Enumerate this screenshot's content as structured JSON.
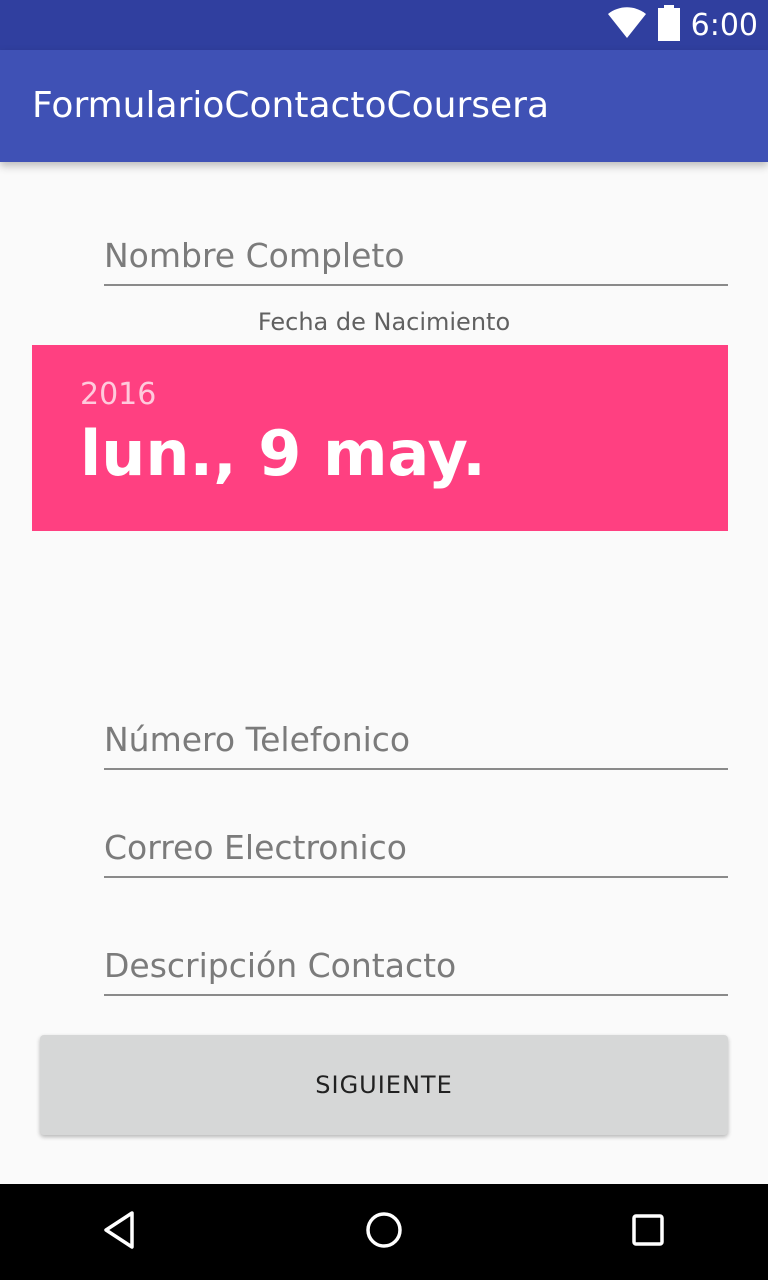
{
  "status_bar": {
    "time": "6:00",
    "icons": [
      "wifi-icon",
      "battery-icon"
    ]
  },
  "app_bar": {
    "title": "FormularioContactoCoursera"
  },
  "form": {
    "name_placeholder": "Nombre Completo",
    "birth_date_label": "Fecha de Nacimiento",
    "date_year": "2016",
    "date_full": "lun., 9 may.",
    "phone_placeholder": "Número Telefonico",
    "email_placeholder": "Correo Electronico",
    "description_placeholder": "Descripción Contacto",
    "next_button_label": "SIGUIENTE"
  },
  "colors": {
    "status_bar": "#303f9f",
    "app_bar": "#3f51b5",
    "date_header": "#ff4081",
    "background": "#fafafa",
    "button": "#d6d7d7"
  },
  "nav_bar": {
    "buttons": [
      "back-icon",
      "home-icon",
      "recents-icon"
    ]
  }
}
